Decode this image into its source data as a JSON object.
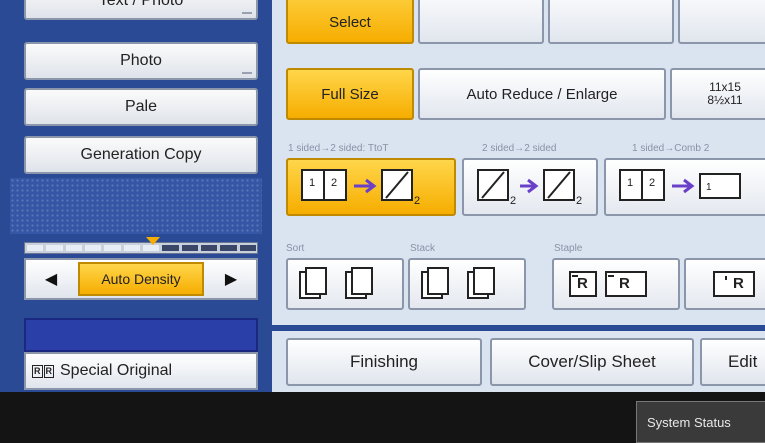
{
  "left_panel": {
    "top_cut_label": "Text / Photo",
    "mode_buttons": [
      "Photo",
      "Pale",
      "Generation Copy"
    ],
    "density": {
      "level": 0.55,
      "steps": 12,
      "left_arrow": "◀",
      "label": "Auto Density",
      "right_arrow": "▶"
    },
    "special_original": {
      "icon_text": [
        "R",
        "R"
      ],
      "label": "Special Original"
    }
  },
  "paper": {
    "select_label": "Select",
    "full_size_label": "Full Size",
    "auto_reduce_label": "Auto Reduce / Enlarge",
    "size_line1": "11x15",
    "size_line2": "8½x11"
  },
  "duplex": {
    "group_labels": [
      "1 sided→2 sided: TtoT",
      "2 sided→2 sided",
      "1 sided→Comb 2"
    ]
  },
  "finishing_options": {
    "group_labels": [
      "Sort",
      "Stack",
      "Staple"
    ],
    "staple_letters": [
      "R",
      "R",
      "R"
    ]
  },
  "tabs": [
    "Finishing",
    "Cover/Slip Sheet",
    "Edit"
  ],
  "status_button": "System Status",
  "colors": {
    "accent_yellow": "#f6ad00",
    "panel_blue": "#2a4a96",
    "body_bg": "#d9e4f0"
  }
}
